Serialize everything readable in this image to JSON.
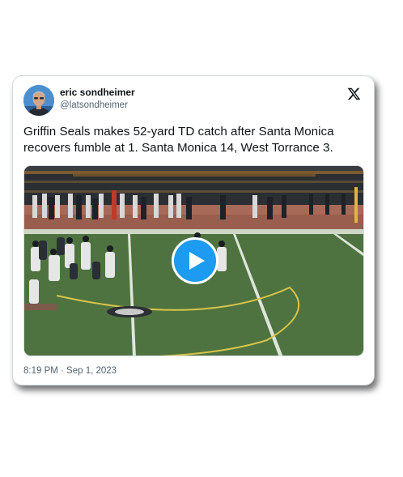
{
  "tweet": {
    "author": {
      "display_name": "eric sondheimer",
      "handle": "@latsondheimer",
      "avatar_icon": "user-avatar"
    },
    "text": "Griffin Seals makes 52-yard TD catch after Santa Monica recovers fumble at 1. Santa Monica 14, West Torrance 3.",
    "timestamp": "8:19 PM · Sep 1, 2023",
    "platform_icon": "x-logo-icon",
    "media": {
      "type": "video",
      "play_icon": "play-icon",
      "accent_color": "#1d9bf0"
    }
  },
  "colors": {
    "text_primary": "#0f1419",
    "text_secondary": "#536471",
    "accent": "#1d9bf0"
  }
}
